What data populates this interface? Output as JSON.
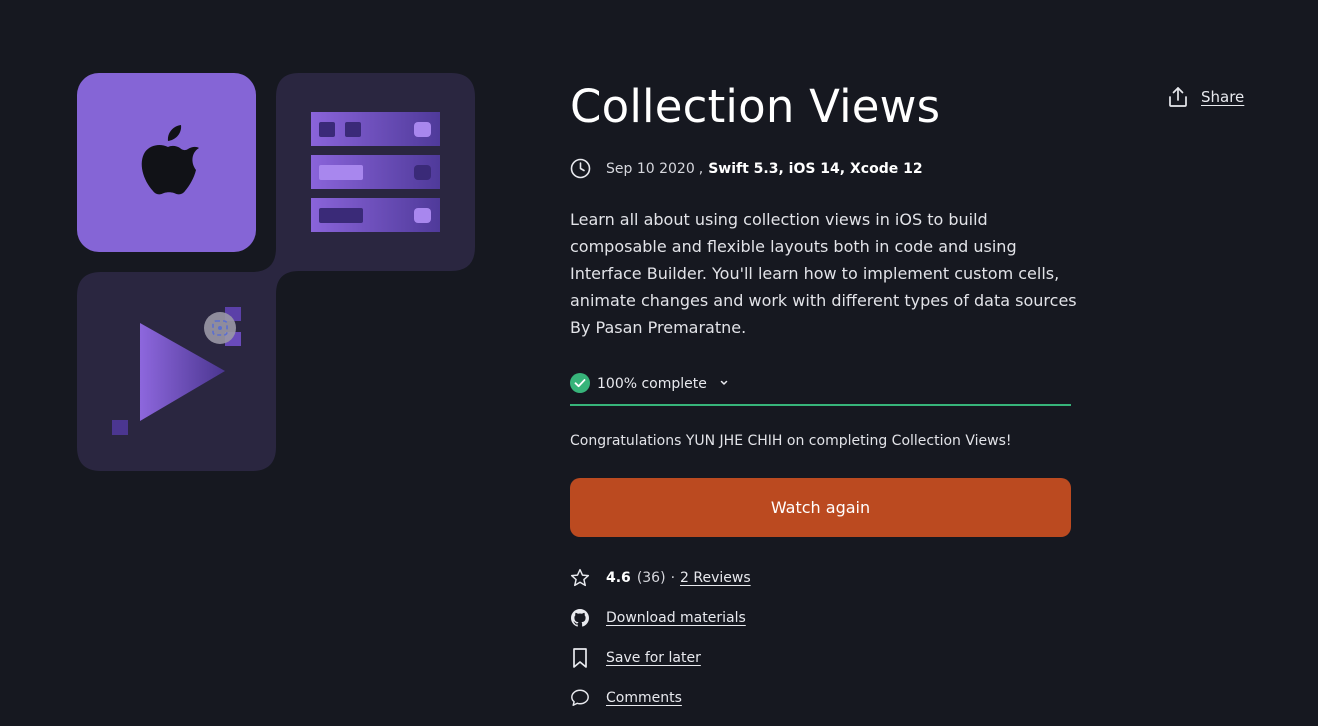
{
  "course": {
    "title": "Collection Views",
    "date": "Sep 10 2020",
    "separator": ",",
    "tech": "Swift 5.3, iOS 14, Xcode 12",
    "description": "Learn all about using collection views in iOS to build composable and flexible layouts both in code and using Interface Builder. You'll learn how to implement custom cells, animate changes and work with different types of data sources By Pasan Premaratne."
  },
  "share": {
    "label": "Share",
    "icon": "share-icon"
  },
  "progress": {
    "label": "100% complete",
    "fraction": 1.0,
    "icon": "check-circle-icon",
    "color": "#37b47a"
  },
  "congrats": "Congratulations YUN JHE CHIH on completing Collection Views!",
  "watch_button": {
    "label": "Watch again",
    "color": "#bb4a20"
  },
  "rating": {
    "value": "4.6",
    "count": "(36)",
    "separator": "·",
    "reviews_link": "2 Reviews",
    "icon": "star-icon"
  },
  "actions": {
    "download": {
      "label": "Download materials",
      "icon": "github-icon"
    },
    "save": {
      "label": "Save for later",
      "icon": "bookmark-icon"
    },
    "comments": {
      "label": "Comments",
      "icon": "comment-icon"
    }
  },
  "colors": {
    "background": "#161820",
    "accent_purple": "#8565d6",
    "tile_dark": "#2a2640"
  }
}
